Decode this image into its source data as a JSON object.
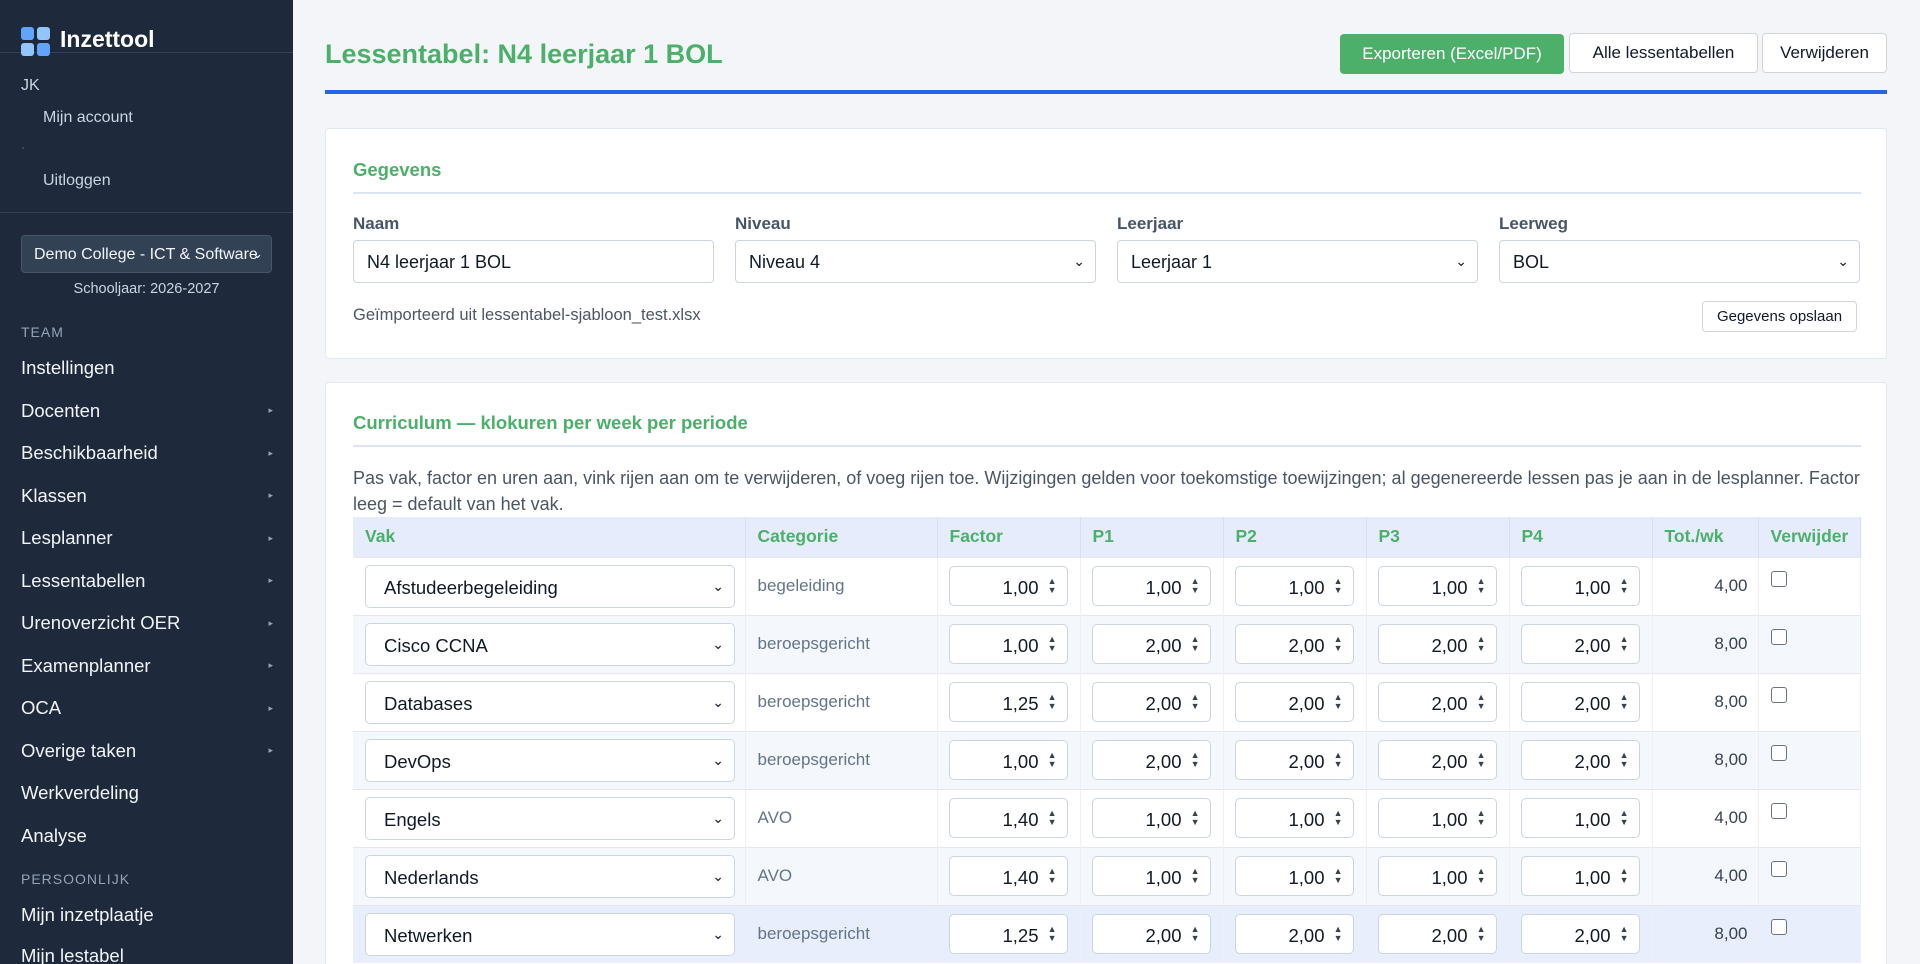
{
  "app": {
    "name": "Inzettool"
  },
  "user": {
    "initials": "JK",
    "account_link": "Mijn account",
    "separator": "·",
    "logout_link": "Uitloggen"
  },
  "org": {
    "selected": "Demo College - ICT & Software",
    "schoolyear": "Schooljaar: 2026-2027"
  },
  "nav": {
    "team_heading": "TEAM",
    "team_items": [
      {
        "label": "Instellingen",
        "has_submenu": false
      },
      {
        "label": "Docenten",
        "has_submenu": true
      },
      {
        "label": "Beschikbaarheid",
        "has_submenu": true
      },
      {
        "label": "Klassen",
        "has_submenu": true
      },
      {
        "label": "Lesplanner",
        "has_submenu": true
      },
      {
        "label": "Lessentabellen",
        "has_submenu": true
      },
      {
        "label": "Urenoverzicht OER",
        "has_submenu": true
      },
      {
        "label": "Examenplanner",
        "has_submenu": true
      },
      {
        "label": "OCA",
        "has_submenu": true
      },
      {
        "label": "Overige taken",
        "has_submenu": true
      },
      {
        "label": "Werkverdeling",
        "has_submenu": false
      },
      {
        "label": "Analyse",
        "has_submenu": false
      }
    ],
    "personal_heading": "PERSOONLIJK",
    "personal_items": [
      {
        "label": "Mijn inzetplaatje"
      },
      {
        "label": "Mijn lestabel"
      }
    ]
  },
  "header": {
    "title": "Lessentabel: N4 leerjaar 1 BOL",
    "export_label": "Exporteren (Excel/PDF)",
    "all_tables_label": "Alle lessentabellen",
    "delete_label": "Verwijderen"
  },
  "details": {
    "heading": "Gegevens",
    "name_label": "Naam",
    "name_value": "N4 leerjaar 1 BOL",
    "level_label": "Niveau",
    "level_value": "Niveau 4",
    "year_label": "Leerjaar",
    "year_value": "Leerjaar 1",
    "path_label": "Leerweg",
    "path_value": "BOL",
    "imported_note": "Geïmporteerd uit lessentabel-sjabloon_test.xlsx",
    "save_label": "Gegevens opslaan"
  },
  "curriculum": {
    "heading": "Curriculum — klokuren per week per periode",
    "instructions": "Pas vak, factor en uren aan, vink rijen aan om te verwijderen, of voeg rijen toe. Wijzigingen gelden voor toekomstige toewijzingen; al gegenereerde lessen pas je aan in de lesplanner. Factor leeg = default van het vak.",
    "columns": [
      "Vak",
      "Categorie",
      "Factor",
      "P1",
      "P2",
      "P3",
      "P4",
      "Tot./wk",
      "Verwijder"
    ],
    "rows": [
      {
        "vak": "Afstudeerbegeleiding",
        "categorie": "begeleiding",
        "factor": "1,00",
        "p1": "1,00",
        "p2": "1,00",
        "p3": "1,00",
        "p4": "1,00",
        "tot": "4,00",
        "delete": false
      },
      {
        "vak": "Cisco CCNA",
        "categorie": "beroepsgericht",
        "factor": "1,00",
        "p1": "2,00",
        "p2": "2,00",
        "p3": "2,00",
        "p4": "2,00",
        "tot": "8,00",
        "delete": false
      },
      {
        "vak": "Databases",
        "categorie": "beroepsgericht",
        "factor": "1,25",
        "p1": "2,00",
        "p2": "2,00",
        "p3": "2,00",
        "p4": "2,00",
        "tot": "8,00",
        "delete": false
      },
      {
        "vak": "DevOps",
        "categorie": "beroepsgericht",
        "factor": "1,00",
        "p1": "2,00",
        "p2": "2,00",
        "p3": "2,00",
        "p4": "2,00",
        "tot": "8,00",
        "delete": false
      },
      {
        "vak": "Engels",
        "categorie": "AVO",
        "factor": "1,40",
        "p1": "1,00",
        "p2": "1,00",
        "p3": "1,00",
        "p4": "1,00",
        "tot": "4,00",
        "delete": false
      },
      {
        "vak": "Nederlands",
        "categorie": "AVO",
        "factor": "1,40",
        "p1": "1,00",
        "p2": "1,00",
        "p3": "1,00",
        "p4": "1,00",
        "tot": "4,00",
        "delete": false
      },
      {
        "vak": "Netwerken",
        "categorie": "beroepsgericht",
        "factor": "1,25",
        "p1": "2,00",
        "p2": "2,00",
        "p3": "2,00",
        "p4": "2,00",
        "tot": "8,00",
        "delete": false
      }
    ]
  },
  "colors": {
    "accent": "#4caf6a",
    "rule": "#2563eb",
    "sidebar": "#1e293b"
  },
  "icons": {
    "logo": "grid-logo-icon",
    "dropdown": "chevron-down-icon",
    "submenu": "caret-right-icon",
    "spinner": "spinner-arrows-icon"
  }
}
